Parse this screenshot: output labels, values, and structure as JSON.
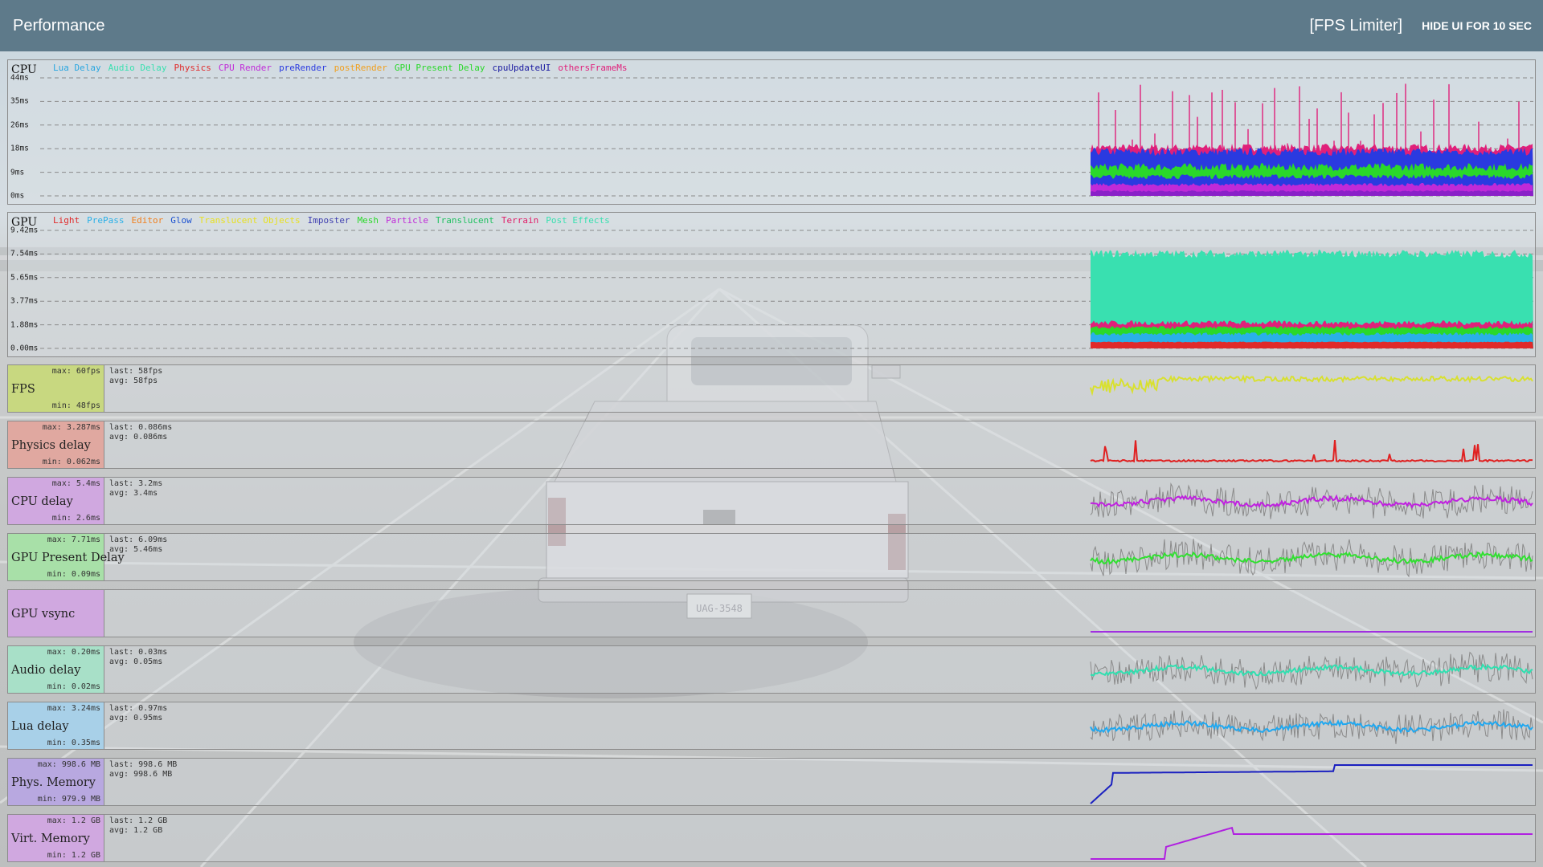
{
  "header": {
    "title": "Performance",
    "fps_limiter": "[FPS Limiter]",
    "hide_ui": "HIDE UI FOR 10 SEC"
  },
  "scene": {
    "license_plate": "UAG-3548"
  },
  "cpu_panel": {
    "title": "CPU",
    "legend": [
      {
        "label": "Lua Delay",
        "color": "#2aa6e0"
      },
      {
        "label": "Audio Delay",
        "color": "#39e0b0"
      },
      {
        "label": "Physics",
        "color": "#e02a2a"
      },
      {
        "label": "CPU Render",
        "color": "#c02ad8"
      },
      {
        "label": "preRender",
        "color": "#2a3ae0"
      },
      {
        "label": "postRender",
        "color": "#f0a020"
      },
      {
        "label": "GPU Present Delay",
        "color": "#2ad82a"
      },
      {
        "label": "cpuUpdateUI",
        "color": "#1a1aa0"
      },
      {
        "label": "othersFrameMs",
        "color": "#e0207a"
      }
    ],
    "y_ticks": [
      "44ms",
      "35ms",
      "26ms",
      "18ms",
      "9ms",
      "0ms"
    ]
  },
  "gpu_panel": {
    "title": "GPU",
    "legend": [
      {
        "label": "Light",
        "color": "#e02a2a"
      },
      {
        "label": "PrePass",
        "color": "#2ab0e8"
      },
      {
        "label": "Editor",
        "color": "#f08020"
      },
      {
        "label": "Glow",
        "color": "#1a50d0"
      },
      {
        "label": "Translucent Objects",
        "color": "#e8e020"
      },
      {
        "label": "Imposter",
        "color": "#4040b0"
      },
      {
        "label": "Mesh",
        "color": "#2ad82a"
      },
      {
        "label": "Particle",
        "color": "#c02ad8"
      },
      {
        "label": "Translucent",
        "color": "#20c060"
      },
      {
        "label": "Terrain",
        "color": "#e0206a"
      },
      {
        "label": "Post Effects",
        "color": "#39e0b0"
      }
    ],
    "y_ticks": [
      "9.42ms",
      "7.54ms",
      "5.65ms",
      "3.77ms",
      "1.88ms",
      "0.00ms"
    ]
  },
  "rows": [
    {
      "name": "FPS",
      "max": "max: 60fps",
      "min": "min: 48fps",
      "last": "last: 58fps",
      "avg": "avg: 58fps",
      "color": "#c8d880",
      "line": "#d8e030"
    },
    {
      "name": "Physics delay",
      "max": "max: 3.287ms",
      "min": "min: 0.062ms",
      "last": "last: 0.086ms",
      "avg": "avg: 0.086ms",
      "color": "#e0a8a0",
      "line": "#e02020"
    },
    {
      "name": "CPU delay",
      "max": "max: 5.4ms",
      "min": "min: 2.6ms",
      "last": "last: 3.2ms",
      "avg": "avg: 3.4ms",
      "color": "#d0a8e0",
      "line": "#c020e0"
    },
    {
      "name": "GPU Present Delay",
      "max": "max: 7.71ms",
      "min": "min: 0.09ms",
      "last": "last: 6.09ms",
      "avg": "avg: 5.46ms",
      "color": "#a8e0a8",
      "line": "#30e030"
    },
    {
      "name": "GPU vsync",
      "max": "",
      "min": "",
      "last": "",
      "avg": "",
      "color": "#d0a8e0",
      "line": "#a030e0"
    },
    {
      "name": "Audio delay",
      "max": "max: 0.20ms",
      "min": "min: 0.02ms",
      "last": "last: 0.03ms",
      "avg": "avg: 0.05ms",
      "color": "#a8e0c8",
      "line": "#30e0b0"
    },
    {
      "name": "Lua delay",
      "max": "max: 3.24ms",
      "min": "min: 0.35ms",
      "last": "last: 0.97ms",
      "avg": "avg: 0.95ms",
      "color": "#a8d0e8",
      "line": "#20a8f0"
    },
    {
      "name": "Phys. Memory",
      "max": "max: 998.6 MB",
      "min": "min: 979.9 MB",
      "last": "last: 998.6 MB",
      "avg": "avg: 998.6 MB",
      "color": "#b8a8e0",
      "line": "#1a20c0"
    },
    {
      "name": "Virt. Memory",
      "max": "max: 1.2 GB",
      "min": "min: 1.2 GB",
      "last": "last: 1.2 GB",
      "avg": "avg: 1.2 GB",
      "color": "#d0a8e0",
      "line": "#b020e0"
    }
  ]
}
